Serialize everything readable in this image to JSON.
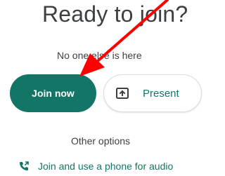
{
  "header": {
    "title": "Ready to join?",
    "status_text": "No one else is here"
  },
  "actions": {
    "join_label": "Join now",
    "present_label": "Present"
  },
  "options": {
    "other_options_label": "Other options",
    "phone_audio_label": "Join and use a phone for audio"
  },
  "colors": {
    "accent": "#137565",
    "annotation_arrow": "#ff0000",
    "text": "#3c4043"
  },
  "icons": {
    "present": "present-screen-icon",
    "phone": "phone-audio-icon",
    "annotation": "red-arrow-annotation"
  }
}
